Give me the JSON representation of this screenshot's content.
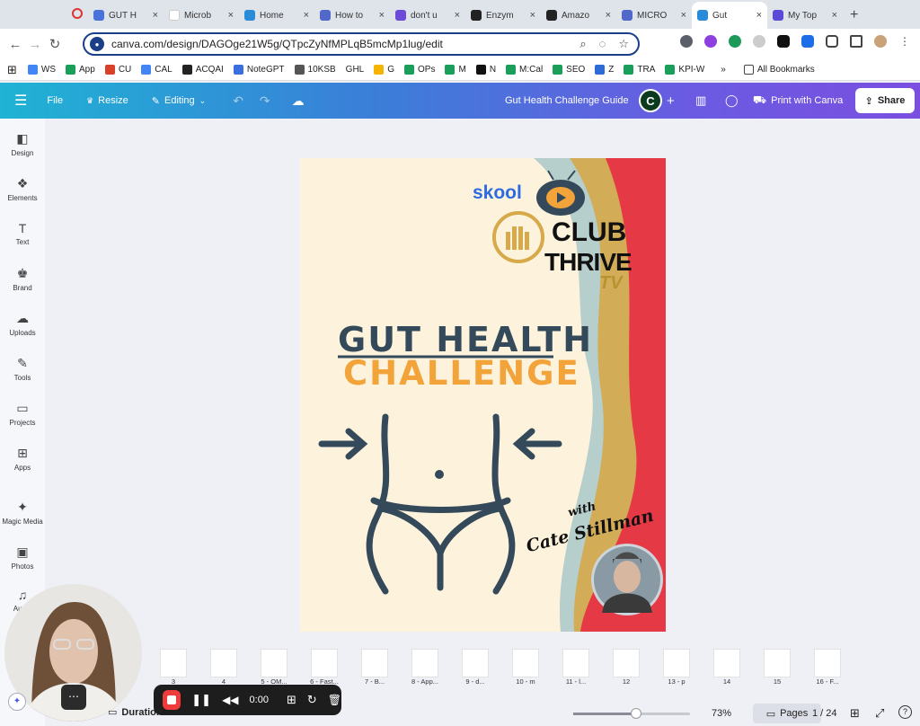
{
  "browser": {
    "tabs": [
      {
        "label": "GUT H",
        "color": "#4a73d9"
      },
      {
        "label": "Microb",
        "color": "#ffffff"
      },
      {
        "label": "Home",
        "color": "#2a8bd8"
      },
      {
        "label": "How to",
        "color": "#5168c9"
      },
      {
        "label": "don't u",
        "color": "#6c4bd6"
      },
      {
        "label": "Enzym",
        "color": "#222222"
      },
      {
        "label": "Amazo",
        "color": "#222222"
      },
      {
        "label": "MICRO",
        "color": "#5168c9"
      },
      {
        "label": "Gut",
        "color": "#2a8bd8"
      },
      {
        "label": "My Top",
        "color": "#5a4bd6"
      }
    ],
    "url": "canva.com/design/DAGOge21W5g/QTpcZyNfMPLqB5mcMp1lug/edit",
    "bookmarks": [
      {
        "label": "WS",
        "color": "#4285f4"
      },
      {
        "label": "App",
        "color": "#1a9f5a"
      },
      {
        "label": "CU",
        "color": "#d8402a"
      },
      {
        "label": "CAL",
        "color": "#4285f4"
      },
      {
        "label": "ACQAI",
        "color": "#222222"
      },
      {
        "label": "NoteGPT",
        "color": "#3b6fe0"
      },
      {
        "label": "10KSB",
        "color": "#555555"
      },
      {
        "label": "GHL",
        "color": "#ffffff"
      },
      {
        "label": "G",
        "color": "#f4b400"
      },
      {
        "label": "OPs",
        "color": "#1a9f5a"
      },
      {
        "label": "M",
        "color": "#1a9f5a"
      },
      {
        "label": "N",
        "color": "#111111"
      },
      {
        "label": "M:Cal",
        "color": "#1a9f5a"
      },
      {
        "label": "SEO",
        "color": "#1a9f5a"
      },
      {
        "label": "Z",
        "color": "#2d6bd8"
      },
      {
        "label": "TRA",
        "color": "#1a9f5a"
      },
      {
        "label": "KPI-W",
        "color": "#1a9f5a"
      }
    ],
    "all_bookmarks": "All Bookmarks"
  },
  "canva_header": {
    "file": "File",
    "resize": "Resize",
    "editing": "Editing",
    "doc_title": "Gut Health Challenge Guide",
    "avatar_letter": "C",
    "print": "Print with Canva",
    "share": "Share"
  },
  "sidebar": [
    {
      "label": "Design",
      "icon": "◧"
    },
    {
      "label": "Elements",
      "icon": "❖"
    },
    {
      "label": "Text",
      "icon": "T"
    },
    {
      "label": "Brand",
      "icon": "♚"
    },
    {
      "label": "Uploads",
      "icon": "☁"
    },
    {
      "label": "Tools",
      "icon": "✎"
    },
    {
      "label": "Projects",
      "icon": "▭"
    },
    {
      "label": "Apps",
      "icon": "⊞"
    },
    {
      "label": "Magic Media",
      "icon": "✦"
    },
    {
      "label": "Photos",
      "icon": "▣"
    },
    {
      "label": "Audio",
      "icon": "♫"
    }
  ],
  "design": {
    "skool": "skool",
    "club": "CLUB",
    "thrive": "THRIVE",
    "tv": "TV",
    "title_line1": "GUT HEALTH",
    "title_line2": "CHALLENGE",
    "with": "with",
    "author": "Cate Stillman",
    "colors": {
      "bg": "#fdf3dc",
      "navy": "#34495a",
      "orange": "#f2a33a",
      "red": "#e63946",
      "teal": "#a9c7c9",
      "gold": "#d6a94a"
    }
  },
  "thumbnails": [
    "3",
    "4",
    "5 - OM...",
    "6 - Fast...",
    "7 - B...",
    "8 - App...",
    "9 - d...",
    "10 - m",
    "11 - l...",
    "12",
    "13 - p",
    "14",
    "15",
    "16 - F..."
  ],
  "recorder": {
    "time": "0:00"
  },
  "footer": {
    "duration": "Duration",
    "zoom": "73%",
    "zoom_level": 0.54,
    "pages_btn": "Pages",
    "page_count": "1 / 24"
  }
}
